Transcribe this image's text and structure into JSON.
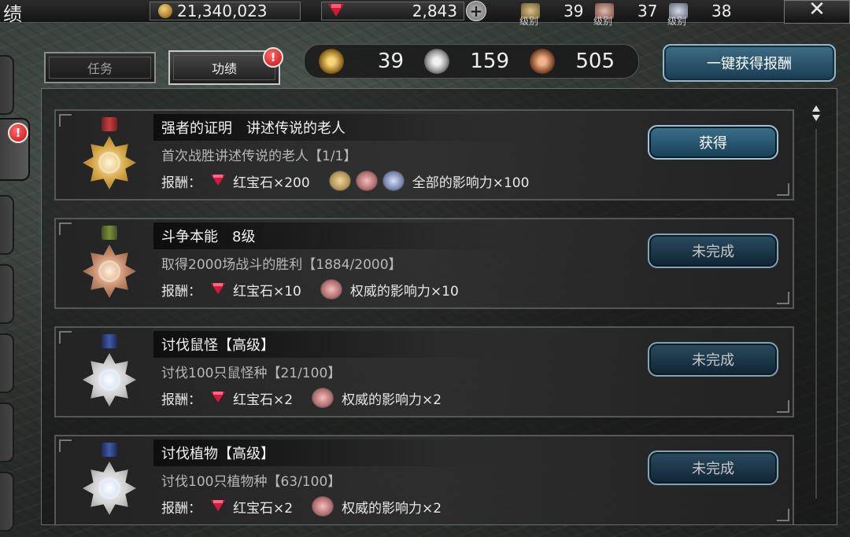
{
  "topbar": {
    "title": "绩",
    "gold": "21,340,023",
    "ruby": "2,843",
    "plus": "+",
    "ranks": [
      {
        "label": "级别",
        "value": "39",
        "icon": "gold-rank-emblem-icon"
      },
      {
        "label": "级别",
        "value": "37",
        "icon": "bronze-rank-emblem-icon"
      },
      {
        "label": "级别",
        "value": "38",
        "icon": "silver-rank-emblem-icon"
      }
    ],
    "close": "✕"
  },
  "side": {
    "alert": "!"
  },
  "tabs": [
    {
      "label": "任务",
      "active": false
    },
    {
      "label": "功绩",
      "active": true,
      "alert": "!"
    }
  ],
  "medal_counts": [
    {
      "icon": "gold-medal-icon",
      "value": "39"
    },
    {
      "icon": "silver-medal-icon",
      "value": "159"
    },
    {
      "icon": "bronze-medal-icon",
      "value": "505"
    }
  ],
  "claim_all": "一键获得报酬",
  "achievements": [
    {
      "medal": "gold-medal",
      "title": "强者的证明　讲述传说的老人",
      "desc": "首次战胜讲述传说的老人【1/1】",
      "reward_label": "报酬：",
      "ruby_reward": "红宝石×200",
      "influence": "全部的影响力×100",
      "button": "获得",
      "button_state": "claimable"
    },
    {
      "medal": "bronze-medal",
      "title": "斗争本能　8级",
      "desc": "取得2000场战斗的胜利【1884/2000】",
      "reward_label": "报酬：",
      "ruby_reward": "红宝石×10",
      "influence": "权威的影响力×10",
      "button": "未完成",
      "button_state": "incomplete"
    },
    {
      "medal": "silver-medal",
      "title": "讨伐鼠怪【高级】",
      "desc": "讨伐100只鼠怪种【21/100】",
      "reward_label": "报酬：",
      "ruby_reward": "红宝石×2",
      "influence": "权威的影响力×2",
      "button": "未完成",
      "button_state": "incomplete"
    },
    {
      "medal": "silver-medal",
      "title": "讨伐植物【高级】",
      "desc": "讨伐100只植物种【63/100】",
      "reward_label": "报酬：",
      "ruby_reward": "红宝石×2",
      "influence": "权威的影响力×2",
      "button": "未完成",
      "button_state": "incomplete"
    }
  ]
}
